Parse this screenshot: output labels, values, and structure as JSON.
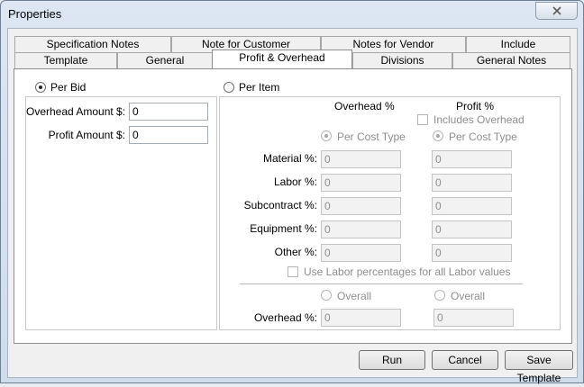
{
  "window": {
    "title": "Properties"
  },
  "tabs_row1": [
    {
      "label": "Specification Notes"
    },
    {
      "label": "Note for Customer"
    },
    {
      "label": "Notes for Vendor"
    },
    {
      "label": "Include"
    }
  ],
  "tabs_row2": [
    {
      "label": "Template"
    },
    {
      "label": "General"
    },
    {
      "label": "Profit & Overhead",
      "active": true
    },
    {
      "label": "Divisions"
    },
    {
      "label": "General Notes"
    }
  ],
  "per_bid": {
    "label": "Per Bid",
    "selected": true,
    "overhead_amount_label": "Overhead Amount $:",
    "overhead_amount_value": "0",
    "profit_amount_label": "Profit Amount $:",
    "profit_amount_value": "0"
  },
  "per_item": {
    "label": "Per Item",
    "selected": false,
    "overhead_header": "Overhead %",
    "profit_header": "Profit %",
    "includes_overhead_label": "Includes Overhead",
    "per_cost_type_label": "Per Cost Type",
    "rows": [
      {
        "label": "Material %:",
        "overhead": "0",
        "profit": "0"
      },
      {
        "label": "Labor %:",
        "overhead": "0",
        "profit": "0"
      },
      {
        "label": "Subcontract %:",
        "overhead": "0",
        "profit": "0"
      },
      {
        "label": "Equipment %:",
        "overhead": "0",
        "profit": "0"
      },
      {
        "label": "Other %:",
        "overhead": "0",
        "profit": "0"
      }
    ],
    "use_labor_label": "Use Labor percentages for all Labor values",
    "overall_label": "Overall",
    "overall_row_label": "Overhead %:",
    "overall_overhead_value": "0",
    "overall_profit_value": "0"
  },
  "buttons": {
    "run": "Run",
    "cancel": "Cancel",
    "save_template": "Save Template"
  },
  "icons": {
    "close": "close-icon"
  }
}
